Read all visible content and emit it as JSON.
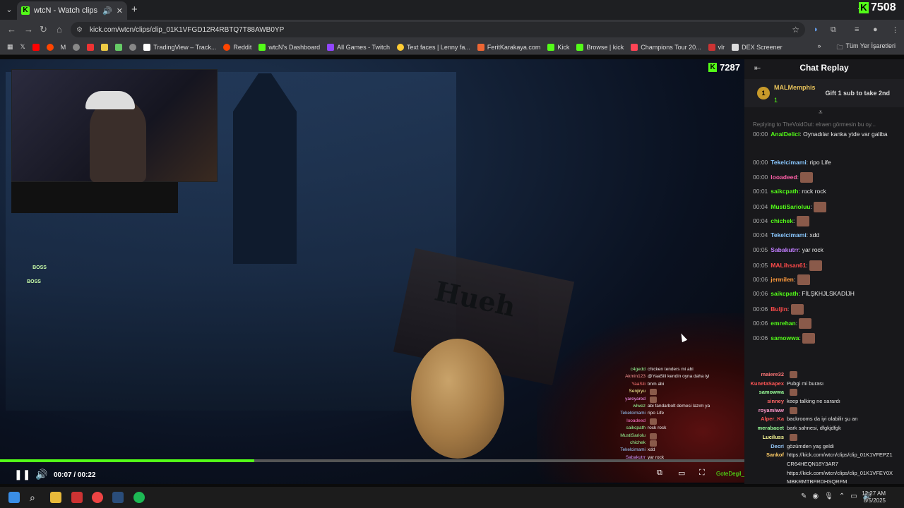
{
  "browser": {
    "tab_title": "wtcN - Watch clips on Kick",
    "url": "kick.com/wtcn/clips/clip_01K1VFGD12R4RBTQ7T88AWB0YP",
    "top_right_viewers": "7508",
    "bookmarks": [
      "TradingView – Track...",
      "Reddit",
      "wtcN's Dashboard",
      "All Games - Twitch",
      "Text faces | Lenny fa...",
      "FeritKarakaya.com",
      "Kick",
      "Browse | kick",
      "Champions Tour 20...",
      "vlr",
      "DEX Screener"
    ],
    "bookmarks_right": "Tüm Yer İşaretleri"
  },
  "video": {
    "viewer_count": "7287",
    "sign_text": "Hueh",
    "boss_label": "BOSS",
    "progress": 0.342,
    "time": "00:07 / 00:22",
    "controls_user": "GoteDegil_AMAR...",
    "overlay_chat": [
      {
        "name": "c4gedd",
        "msg": "chicken tenders mi abi",
        "color": "#9f9"
      },
      {
        "name": "Akmin123",
        "msg": "@YaaSili kendin oyna daha iyi",
        "color": "#f99"
      },
      {
        "name": "YaaSili",
        "msg": "tmm abi",
        "color": "#f77"
      },
      {
        "name": "Senjiryu",
        "msg": "",
        "color": "#ff9"
      },
      {
        "name": "yareyared",
        "msg": "",
        "color": "#f9f"
      },
      {
        "name": "wlwez",
        "msg": "abi fandarbolt demesi lazım ya",
        "color": "#9f9"
      },
      {
        "name": "Tekelcimami",
        "msg": "ripo Life",
        "color": "#9cf"
      },
      {
        "name": "looadeed",
        "msg": "",
        "color": "#f7c"
      },
      {
        "name": "saikcpath",
        "msg": "rock rock",
        "color": "#9f9"
      },
      {
        "name": "MustiSariolu",
        "msg": "",
        "color": "#9f9"
      },
      {
        "name": "chichek",
        "msg": "",
        "color": "#9f9"
      },
      {
        "name": "Tekelcimami",
        "msg": "xdd",
        "color": "#9cf"
      },
      {
        "name": "Sabakutrr",
        "msg": "yar rock",
        "color": "#c9f"
      }
    ]
  },
  "chat": {
    "title": "Chat Replay",
    "gift": {
      "badge": "1",
      "user": "MALMemphis",
      "count": "1",
      "text": "Gift 1 sub to take 2nd"
    },
    "reply_text": "Replying to TheVoidOut: elraen görmesin bu oy...",
    "messages": [
      {
        "ts": "00:00",
        "name": "AnalDelici",
        "color": "#53fc18",
        "text": "Oynadılar kanka ytde var galiba"
      },
      {
        "ts": "00:00",
        "name": "Tekelcimami",
        "color": "#8ac8ff",
        "text": "ripo Life"
      },
      {
        "ts": "00:00",
        "name": "looadeed",
        "color": "#ff5fa8",
        "text": ""
      },
      {
        "ts": "00:01",
        "name": "saikcpath",
        "color": "#53fc18",
        "text": "rock rock"
      },
      {
        "ts": "00:04",
        "name": "MustiSarioluu",
        "color": "#53fc18",
        "text": ""
      },
      {
        "ts": "00:04",
        "name": "chichek",
        "color": "#53fc18",
        "text": ""
      },
      {
        "ts": "00:04",
        "name": "Tekelcimami",
        "color": "#8ac8ff",
        "text": "xdd"
      },
      {
        "ts": "00:05",
        "name": "Sabakutrr",
        "color": "#c17dff",
        "text": "yar rock"
      },
      {
        "ts": "00:05",
        "name": "MALihsan61",
        "color": "#ff4b4b",
        "text": ""
      },
      {
        "ts": "00:06",
        "name": "jermilen",
        "color": "#ff9a3c",
        "text": ""
      },
      {
        "ts": "00:06",
        "name": "saikcpath",
        "color": "#53fc18",
        "text": "FİLŞKHJLSKADİJH"
      },
      {
        "ts": "00:06",
        "name": "Buljin",
        "color": "#ff4b4b",
        "text": ""
      },
      {
        "ts": "00:06",
        "name": "emrehan",
        "color": "#53fc18",
        "text": ""
      },
      {
        "ts": "00:06",
        "name": "samowwa",
        "color": "#53fc18",
        "text": ""
      }
    ],
    "bottom_chat": [
      {
        "name": "maiere32",
        "color": "#f77",
        "msg": ""
      },
      {
        "name": "KunetaSapex",
        "color": "#f55",
        "msg": "Pubgi mi burası"
      },
      {
        "name": "samowwa",
        "color": "#9f9",
        "msg": ""
      },
      {
        "name": "sinney",
        "color": "#f66",
        "msg": "keep talking ne sarardı"
      },
      {
        "name": "royamiww",
        "color": "#f9c",
        "msg": ""
      },
      {
        "name": "Alper_Ka",
        "color": "#f55",
        "msg": "backrooms da iyi olabilir şu an"
      },
      {
        "name": "merabacet",
        "color": "#9f9",
        "msg": "bark sahnesi, dfgkjdfgk"
      },
      {
        "name": "Luciluss",
        "color": "#ff9",
        "msg": ""
      },
      {
        "name": "Decri",
        "color": "#9cf",
        "msg": "gözümden yaş geldi"
      },
      {
        "name": "Sankof",
        "color": "#fc6",
        "msg": "https://kick.com/wtcn/clips/clip_01K1VFEPZ1"
      },
      {
        "name": "",
        "color": "#fff",
        "msg": "CR64HEQN18Y3AR7"
      },
      {
        "name": "",
        "color": "#fff",
        "msg": "https://kick.com/wtcn/clips/clip_01K1VFEY0X"
      },
      {
        "name": "",
        "color": "#fff",
        "msg": "MBKRMTBFRDHSQRFM"
      },
      {
        "name": "emrehan",
        "color": "#fff",
        "msg": ""
      },
      {
        "name": "Senjiryu",
        "color": "#fff",
        "msg": ""
      }
    ]
  },
  "taskbar": {
    "time": "12:27 AM",
    "date": "8/5/2025"
  }
}
